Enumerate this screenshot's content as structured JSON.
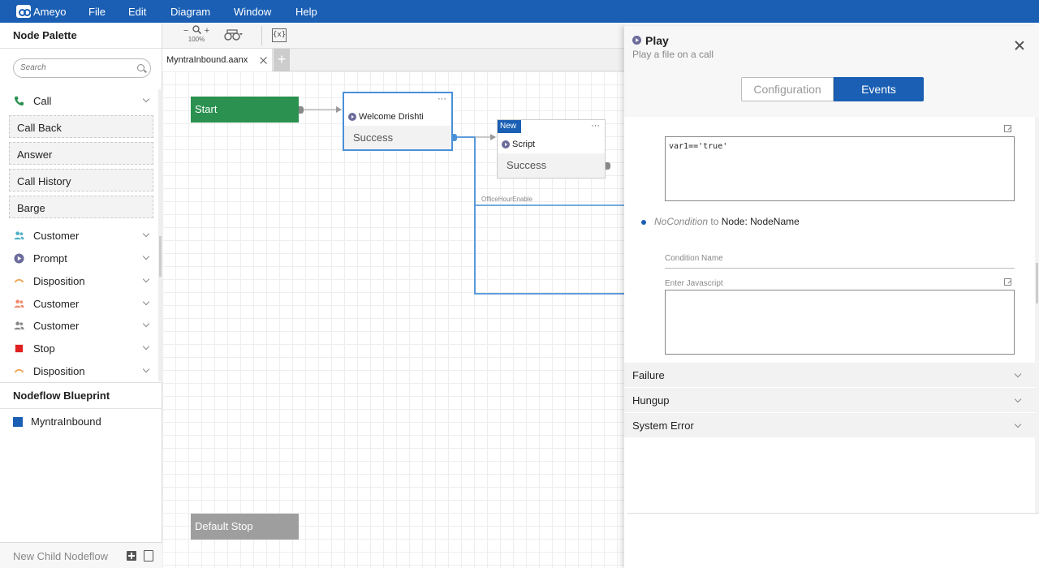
{
  "app": {
    "brand": "Ameyo",
    "menu": [
      "File",
      "Edit",
      "Diagram",
      "Window",
      "Help"
    ]
  },
  "palette": {
    "title": "Node Palette",
    "search_placeholder": "Search",
    "call_label": "Call",
    "call_subitems": [
      "Call Back",
      "Answer",
      "Call History",
      "Barge"
    ],
    "groups": [
      {
        "label": "Customer",
        "icon": "customer-icon",
        "color": "#4fb0c6"
      },
      {
        "label": "Prompt",
        "icon": "prompt-icon",
        "color": "#6c6c9c"
      },
      {
        "label": "Disposition",
        "icon": "disposition-icon",
        "color": "#f0a04b"
      },
      {
        "label": "Customer",
        "icon": "customer-icon",
        "color": "#f08a6b"
      },
      {
        "label": "Customer",
        "icon": "customer-icon",
        "color": "#888888"
      },
      {
        "label": "Stop",
        "icon": "stop-icon",
        "color": "#e02020"
      },
      {
        "label": "Disposition",
        "icon": "disposition-icon",
        "color": "#f0a04b"
      }
    ]
  },
  "blueprint": {
    "title": "Nodeflow Blueprint",
    "item": "MyntraInbound"
  },
  "footer": {
    "new_child": "New Child Nodeflow"
  },
  "toolbar": {
    "zoom": "100%",
    "zoom_out": "−",
    "zoom_in": "+",
    "var_button": "{x}"
  },
  "tabs": {
    "active": "MyntraInbound.aanx",
    "add": "+"
  },
  "canvas": {
    "start": "Start",
    "node1": {
      "title": "Welcome Drishti",
      "output": "Success",
      "menu": "···"
    },
    "node2": {
      "badge": "New",
      "title": "Script",
      "output": "Success",
      "menu": "···"
    },
    "edge_label": "OfficeHourEnable",
    "default_stop": "Default Stop"
  },
  "panel": {
    "title": "Play",
    "subtitle": "Play a file on a call",
    "tab_config": "Configuration",
    "tab_events": "Events",
    "script1": "var1=='true'",
    "condition": {
      "name": "NoCondition",
      "to": "to",
      "target": "Node: NodeName"
    },
    "condition_name_label": "Condition Name",
    "js_label": "Enter Javascript",
    "sections": [
      "Failure",
      "Hungup",
      "System Error"
    ]
  }
}
